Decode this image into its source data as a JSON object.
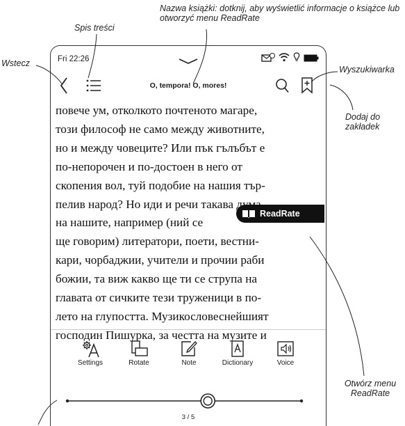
{
  "callouts": {
    "book_name": "Nazwa książki: dotknij, aby wyświetlić informacje o książce lub otworzyć menu ReadRate",
    "toc": "Spis treści",
    "back": "Wstecz",
    "search": "Wyszukiwarka",
    "bookmark": "Dodaj do zakładek",
    "readrate": "Otwórz menu ReadRate"
  },
  "status": {
    "time": "Fri 22:26"
  },
  "toolbar": {
    "title": "O, tempora! O, mores!"
  },
  "book": {
    "lines": [
      "повече ум, отколкото почтеното магаре,",
      "този философ не само между животните,",
      "но и между човеците? Или пък гълъбът е",
      "по-непорочен и по-достоен в него от",
      "скопения вол, туй подобие на нашия тър-",
      "пелив народ? Но иди и речи такава дума",
      "на нашите, например (ний се",
      "ще говорим) литератори, поети, вестни-",
      "кари, чорбаджии, учители и прочии раби",
      "божии, та виж какво ще ти се струпа на",
      "главата от сичките тези труженици в по-",
      "лето на глупостта. Музикословеснейшият",
      "господин Пишурка, за честта на музите и"
    ]
  },
  "readrate": {
    "label": "ReadRate"
  },
  "actions": [
    {
      "icon": "settings-icon",
      "label": "Settings"
    },
    {
      "icon": "rotate-icon",
      "label": "Rotate"
    },
    {
      "icon": "note-icon",
      "label": "Note"
    },
    {
      "icon": "dictionary-icon",
      "label": "Dictionary"
    },
    {
      "icon": "voice-icon",
      "label": "Voice"
    }
  ],
  "progress": {
    "page_label": "3 / 5",
    "value": 0.6
  }
}
